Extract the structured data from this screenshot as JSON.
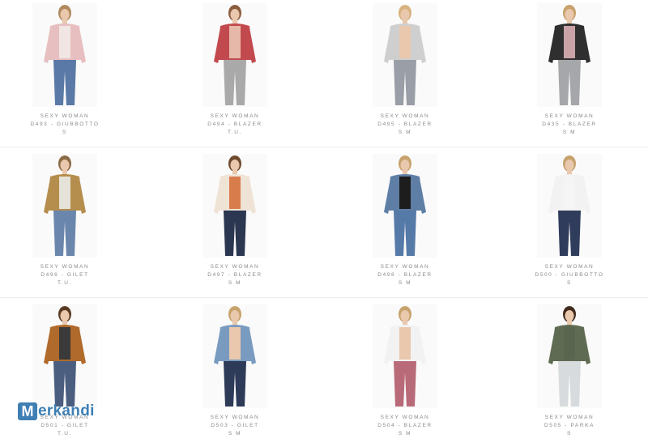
{
  "products": [
    {
      "brand": "SEXY WOMAN",
      "name": "D493 - GIUBBOTTO",
      "size": "S",
      "colors": {
        "top": "#e8bfc0",
        "body": "#f1e6e4",
        "legs": "#5a79a6",
        "skin": "#e9c8ae",
        "hair": "#b08a5e"
      }
    },
    {
      "brand": "SEXY WOMAN",
      "name": "D494 - BLAZER",
      "size": "T.U.",
      "colors": {
        "top": "#c24a4f",
        "body": "#e6b8a9",
        "legs": "#a9a9aa",
        "skin": "#e9c8ae",
        "hair": "#8a5d3d"
      }
    },
    {
      "brand": "SEXY WOMAN",
      "name": "D495 - BLAZER",
      "size": "S M",
      "colors": {
        "top": "#cfcfcf",
        "body": "#e9c8ae",
        "legs": "#9a9ea6",
        "skin": "#e9c8ae",
        "hair": "#d7b27e"
      }
    },
    {
      "brand": "SEXY WOMAN",
      "name": "D435 - BLAZER",
      "size": "S M",
      "colors": {
        "top": "#2f2f2f",
        "body": "#c9a3a8",
        "legs": "#a5a7aa",
        "skin": "#e9c8ae",
        "hair": "#c7a26c"
      }
    },
    {
      "brand": "SEXY WOMAN",
      "name": "D496 - GILET",
      "size": "T.U.",
      "colors": {
        "top": "#b58d4c",
        "body": "#e5e2d7",
        "legs": "#6b86ad",
        "skin": "#e9c8ae",
        "hair": "#8a6a44"
      }
    },
    {
      "brand": "SEXY WOMAN",
      "name": "D497 - BLAZER",
      "size": "S M",
      "colors": {
        "top": "#efe3d6",
        "body": "#d97c4b",
        "legs": "#2b3650",
        "skin": "#e9c8ae",
        "hair": "#6f4a2e"
      }
    },
    {
      "brand": "SEXY WOMAN",
      "name": "D498 - BLAZER",
      "size": "S M",
      "colors": {
        "top": "#5e7ea6",
        "body": "#1d1d1d",
        "legs": "#567aa8",
        "skin": "#e9c8ae",
        "hair": "#c7a26c"
      }
    },
    {
      "brand": "SEXY WOMAN",
      "name": "D500 - GIUBBOTTO",
      "size": "S",
      "colors": {
        "top": "#f2f2f2",
        "body": "#f5f5f5",
        "legs": "#2f3c5c",
        "skin": "#e9c8ae",
        "hair": "#c7a26c"
      }
    },
    {
      "brand": "SEXY WOMAN",
      "name": "D501 - GILET",
      "size": "T.U.",
      "colors": {
        "top": "#b06a2b",
        "body": "#3a3a3a",
        "legs": "#4b5e80",
        "skin": "#e9c8ae",
        "hair": "#5b3b24"
      }
    },
    {
      "brand": "SEXY WOMAN",
      "name": "D503 - GILET",
      "size": "S M",
      "colors": {
        "top": "#7a9bc0",
        "body": "#e9c8ae",
        "legs": "#2d3a58",
        "skin": "#e9c8ae",
        "hair": "#c7a26c"
      }
    },
    {
      "brand": "SEXY WOMAN",
      "name": "D504 - BLAZER",
      "size": "S M",
      "colors": {
        "top": "#f2f2f2",
        "body": "#e9c8ae",
        "legs": "#b96a78",
        "skin": "#e9c8ae",
        "hair": "#c7a26c"
      }
    },
    {
      "brand": "SEXY WOMAN",
      "name": "D505 - PARKA",
      "size": "S",
      "colors": {
        "top": "#5f6b52",
        "body": "#5a6550",
        "legs": "#d7dbdd",
        "skin": "#e9c8ae",
        "hair": "#3f2a1c"
      }
    }
  ],
  "watermark": {
    "letter": "M",
    "rest": "erkandi",
    "color": "#3e7fb4"
  }
}
